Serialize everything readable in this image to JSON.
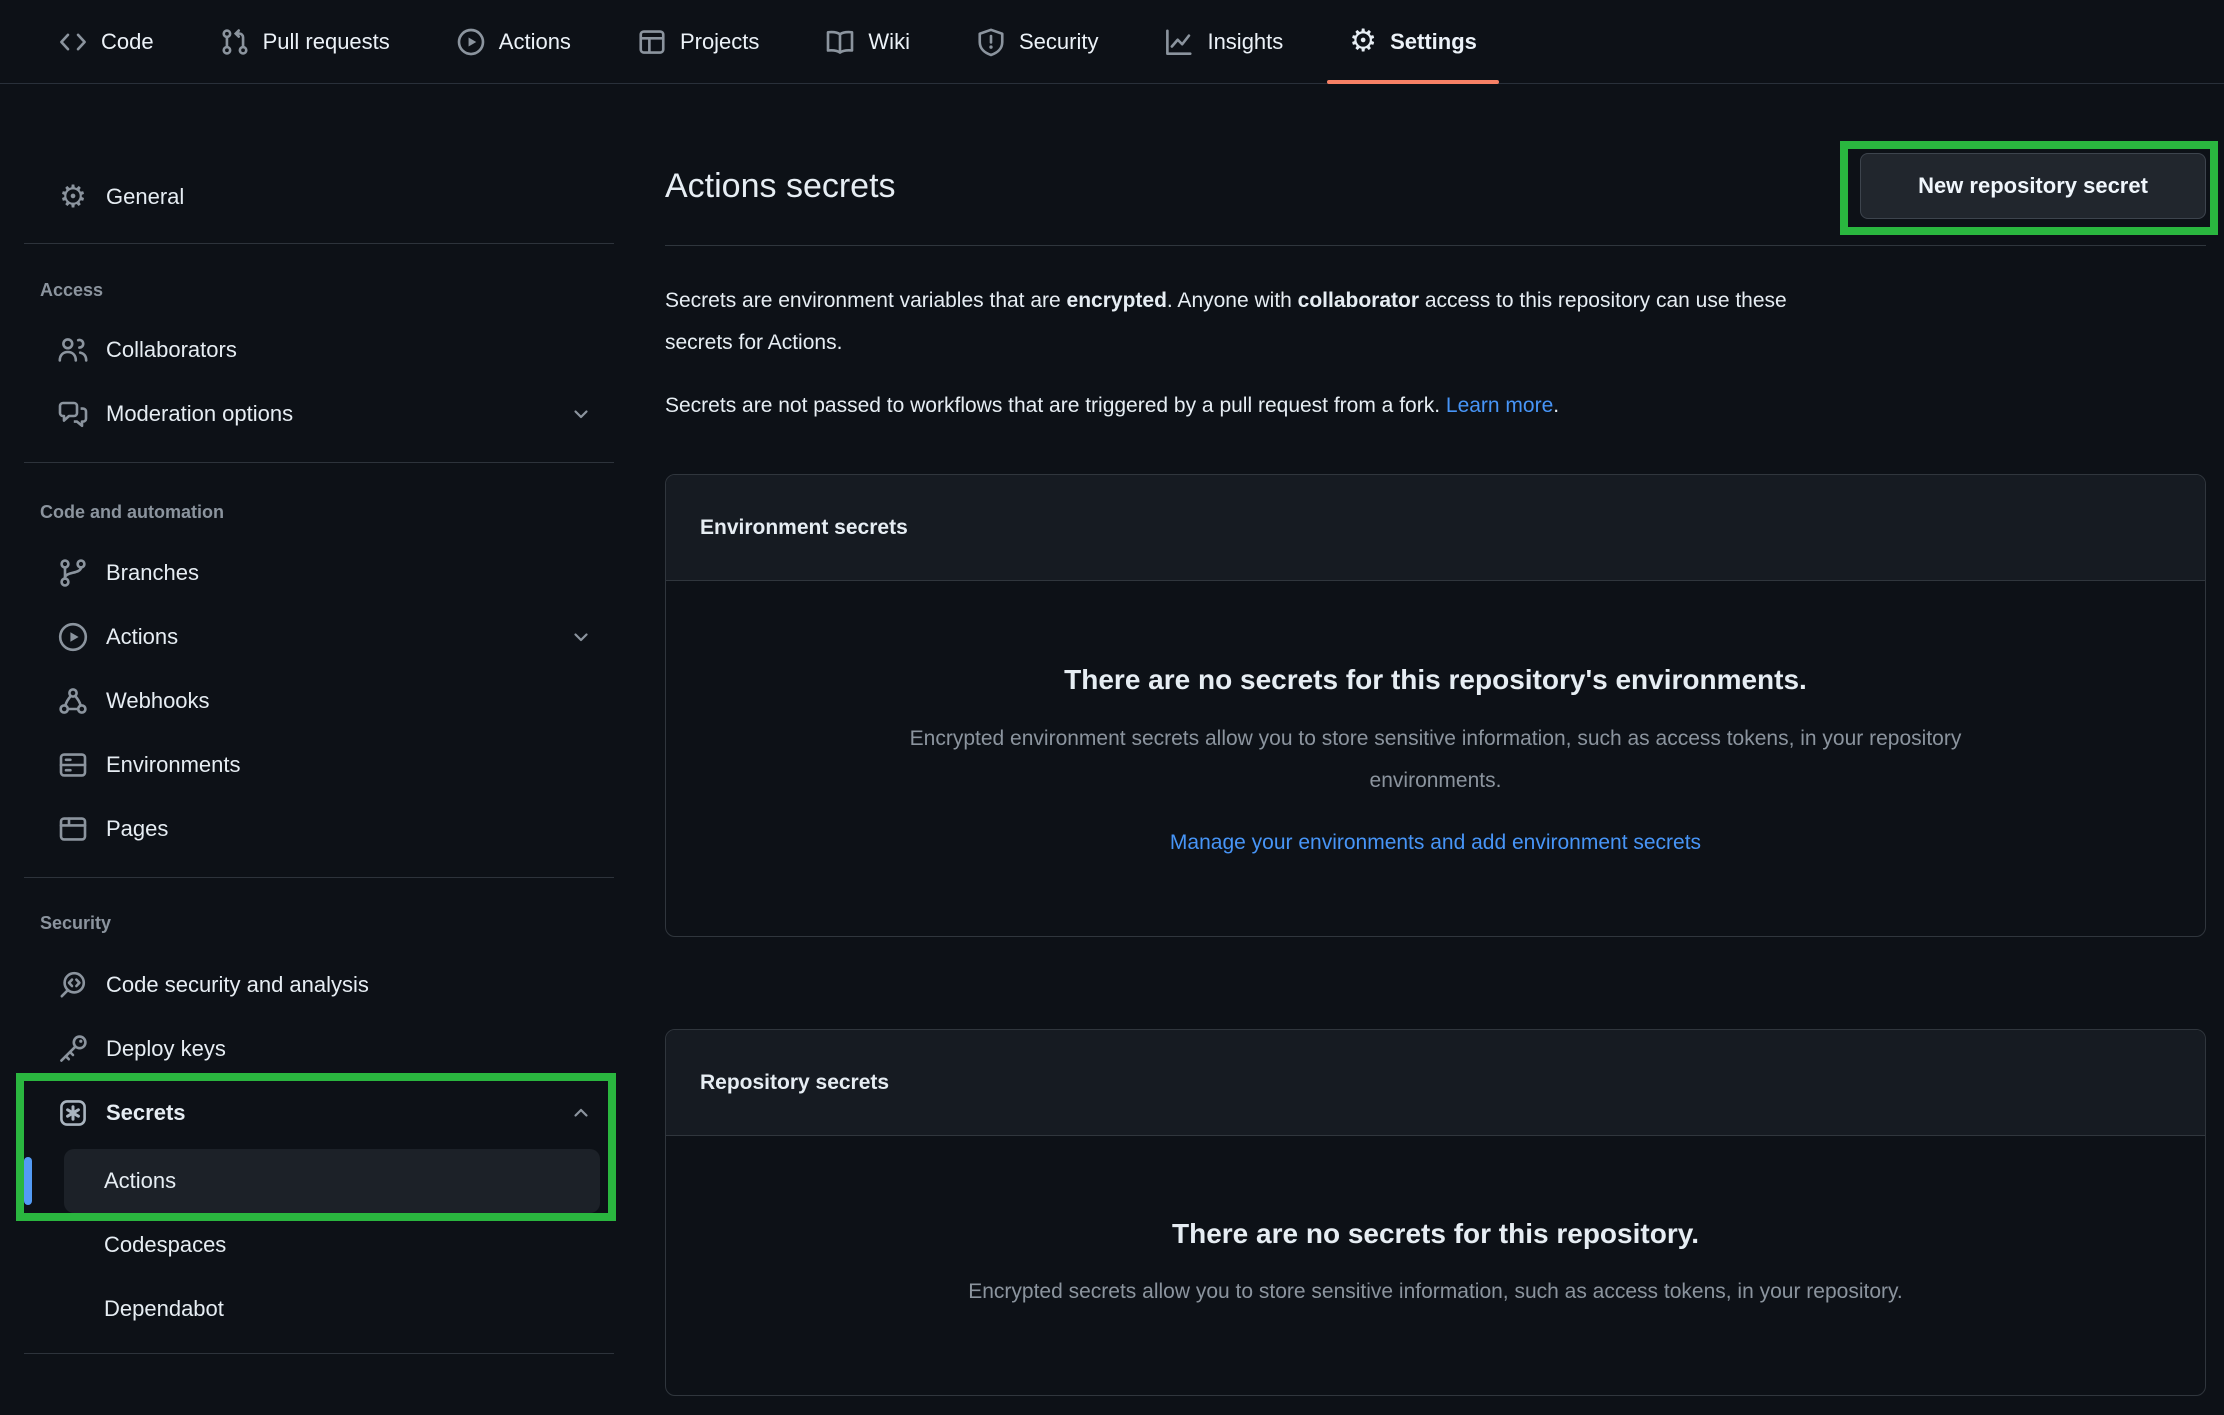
{
  "nav": {
    "tabs": [
      {
        "label": "Code",
        "icon": "code-icon",
        "active": false
      },
      {
        "label": "Pull requests",
        "icon": "git-pull-request-icon",
        "active": false
      },
      {
        "label": "Actions",
        "icon": "play-icon",
        "active": false
      },
      {
        "label": "Projects",
        "icon": "project-board-icon",
        "active": false
      },
      {
        "label": "Wiki",
        "icon": "book-icon",
        "active": false
      },
      {
        "label": "Security",
        "icon": "shield-icon",
        "active": false
      },
      {
        "label": "Insights",
        "icon": "graph-icon",
        "active": false
      },
      {
        "label": "Settings",
        "icon": "gear-icon",
        "active": true
      }
    ],
    "active_underline_color": "#f78166"
  },
  "sidebar": {
    "general": {
      "label": "General",
      "icon": "gear-icon"
    },
    "sections": [
      {
        "title": "Access",
        "items": [
          {
            "label": "Collaborators",
            "icon": "people-icon"
          },
          {
            "label": "Moderation options",
            "icon": "comment-discussion-icon",
            "chevron": "down"
          }
        ]
      },
      {
        "title": "Code and automation",
        "items": [
          {
            "label": "Branches",
            "icon": "git-branch-icon"
          },
          {
            "label": "Actions",
            "icon": "play-icon",
            "chevron": "down"
          },
          {
            "label": "Webhooks",
            "icon": "webhook-icon"
          },
          {
            "label": "Environments",
            "icon": "server-icon"
          },
          {
            "label": "Pages",
            "icon": "browser-icon"
          }
        ]
      },
      {
        "title": "Security",
        "items": [
          {
            "label": "Code security and analysis",
            "icon": "codescan-icon"
          },
          {
            "label": "Deploy keys",
            "icon": "key-icon"
          },
          {
            "label": "Secrets",
            "icon": "asterisk-box-icon",
            "chevron": "up",
            "expanded": true,
            "subitems": [
              {
                "label": "Actions",
                "selected": true
              },
              {
                "label": "Codespaces",
                "selected": false
              },
              {
                "label": "Dependabot",
                "selected": false
              }
            ]
          }
        ]
      }
    ],
    "selected_bar_color": "#539bf5"
  },
  "main": {
    "title": "Actions secrets",
    "new_secret_button": "New repository secret",
    "intro": {
      "line1_a": "Secrets are environment variables that are ",
      "line1_bold1": "encrypted",
      "line1_b": ". Anyone with ",
      "line1_bold2": "collaborator",
      "line1_c": " access to this repository can use these",
      "line2": "secrets for Actions.",
      "p2_text": "Secrets are not passed to workflows that are triggered by a pull request from a fork. ",
      "p2_link": "Learn more",
      "p2_end": "."
    },
    "environment_secrets": {
      "header": "Environment secrets",
      "empty_title": "There are no secrets for this repository's environments.",
      "empty_desc_line1": "Encrypted environment secrets allow you to store sensitive information, such as access tokens, in your repository",
      "empty_desc_line2": "environments.",
      "link": "Manage your environments and add environment secrets"
    },
    "repository_secrets": {
      "header": "Repository secrets",
      "empty_title": "There are no secrets for this repository.",
      "empty_desc": "Encrypted secrets allow you to store sensitive information, such as access tokens, in your repository."
    }
  },
  "annotations": {
    "highlight_color": "#2ab63f",
    "targets": [
      "secrets-sidebar-group",
      "new-repository-secret-button"
    ]
  },
  "colors": {
    "background": "#0d1117",
    "panel_header": "#161b22",
    "border": "#30363d",
    "text_primary": "#e6edf3",
    "text_secondary": "#8b949e",
    "link": "#4795f7",
    "active_tab_underline": "#f78166",
    "annotation_green": "#2ab63f",
    "selected_bar_blue": "#539bf5"
  }
}
